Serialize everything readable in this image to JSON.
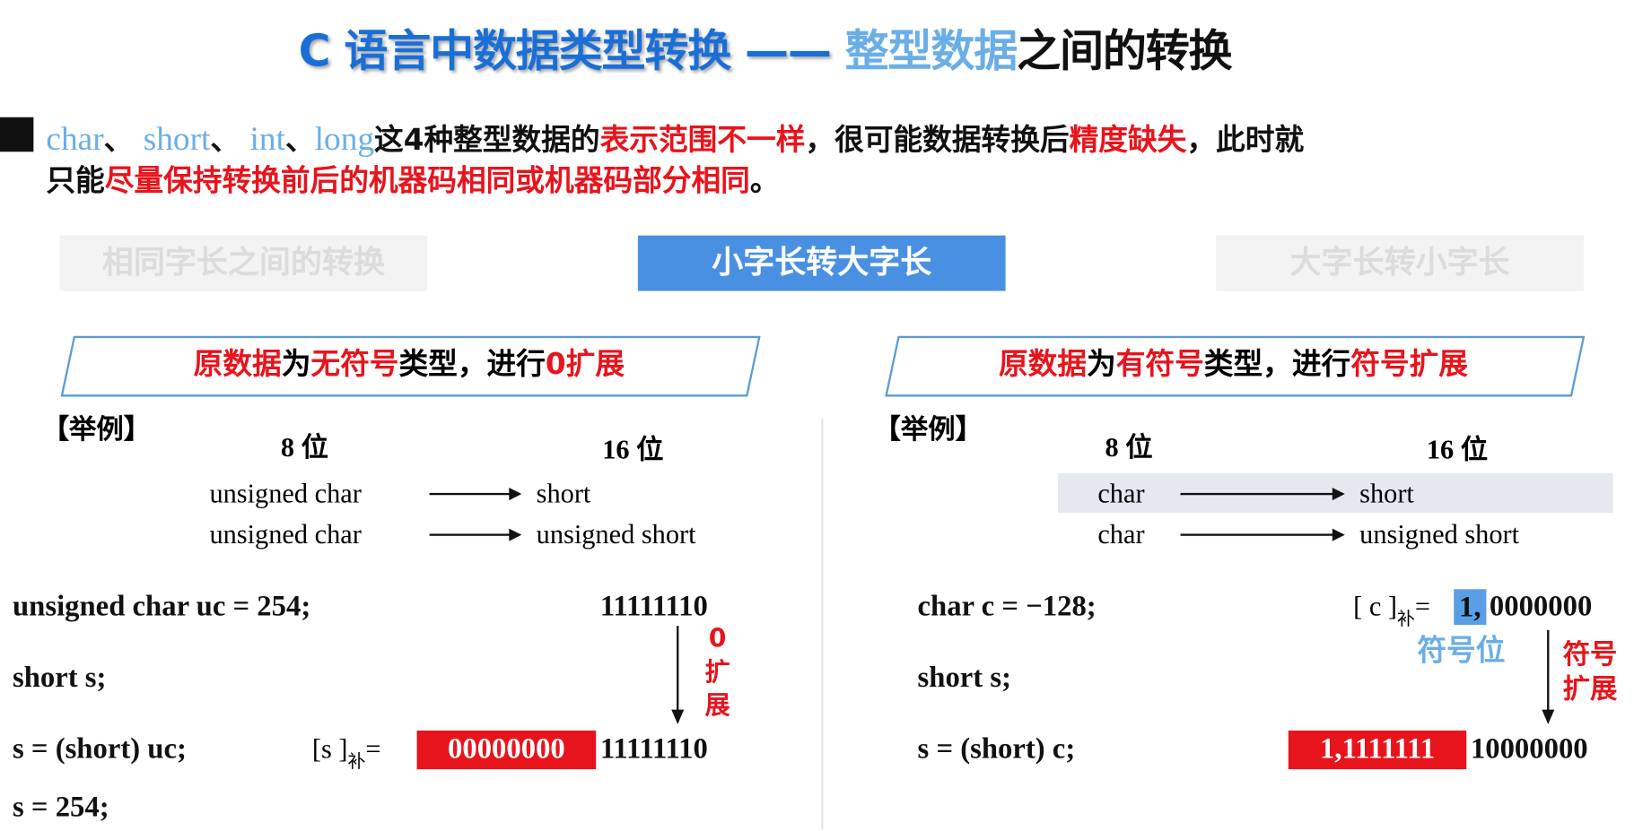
{
  "title": {
    "part1": "C 语言中数据类型转换",
    "dash": "——",
    "part2": "整型数据",
    "part3": "之间的转换"
  },
  "intro": {
    "types": [
      "char",
      "short",
      "int",
      "long"
    ],
    "sep": "、",
    "t1": "这4种整型数据的",
    "r1": "表示范围不一样",
    "t2": "，很可能数据转换后",
    "r2": "精度缺失",
    "t3": "，此时就",
    "t4": "只能",
    "r3": "尽量保持转换前后的机器码相同或机器码部分相同",
    "t5": "。"
  },
  "tabs": [
    {
      "label": "相同字长之间的转换",
      "active": false
    },
    {
      "label": "小字长转大字长",
      "active": true
    },
    {
      "label": "大字长转小字长",
      "active": false
    }
  ],
  "left": {
    "header": {
      "r1": "原数据",
      "b1": "为",
      "r2": "无符号",
      "b2": "类型，进行",
      "r3": "0扩展"
    },
    "example": "【举例】",
    "col8": "8 位",
    "col16": "16 位",
    "rows": [
      {
        "from": "unsigned  char",
        "to": "short"
      },
      {
        "from": "unsigned  char",
        "to": "unsigned short"
      }
    ],
    "code": [
      "unsigned  char  uc = 254;",
      "short  s;",
      "s = (short)  uc;",
      "s = 254;"
    ],
    "bits_src": "11111110",
    "ext_label": [
      "0",
      "扩",
      "展"
    ],
    "s_label": "[s ]",
    "s_sub": "补",
    "eq": "=",
    "ext_bits": "00000000",
    "low_bits": "11111110"
  },
  "right": {
    "header": {
      "r1": "原数据",
      "b1": "为",
      "r2": "有符号",
      "b2": "类型，进行",
      "r3": "符号扩展"
    },
    "example": "【举例】",
    "col8": "8 位",
    "col16": "16 位",
    "rows": [
      {
        "from": "char",
        "to": "short"
      },
      {
        "from": "char",
        "to": "unsigned short"
      }
    ],
    "code": [
      "char  c = −128;",
      "short  s;",
      "s = (short)  c;"
    ],
    "c_label": "[ c ]",
    "c_sub": "补",
    "eq": "=",
    "sign_bit": "1,",
    "c_rest": "0000000",
    "sign_label": "符号位",
    "ext_label": [
      "符号",
      "扩展"
    ],
    "ext_bits": "1,1111111",
    "low_bits": "10000000"
  }
}
